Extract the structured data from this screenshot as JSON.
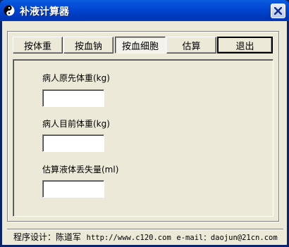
{
  "window": {
    "title": "补液计算器",
    "close_label": "×"
  },
  "toolbar": {
    "buttons": [
      {
        "label": "按体重",
        "state": "normal"
      },
      {
        "label": "按血钠",
        "state": "normal"
      },
      {
        "label": "按血细胞",
        "state": "pressed"
      },
      {
        "label": "估算",
        "state": "normal"
      },
      {
        "label": "退出",
        "state": "default"
      }
    ]
  },
  "form": {
    "fields": [
      {
        "label": "病人原先体重(kg)",
        "value": ""
      },
      {
        "label": "病人目前体重(kg)",
        "value": ""
      },
      {
        "label": "估算液体丢失量(ml)",
        "value": ""
      }
    ]
  },
  "status": {
    "designer": "程序设计：陈道军",
    "url": "http://www.c120.com",
    "email": "e-mail：daojun@21cn.com"
  },
  "colors": {
    "title_bar": "#0043cf",
    "face": "#ece9d8",
    "close_x": "#0d2c8c"
  }
}
